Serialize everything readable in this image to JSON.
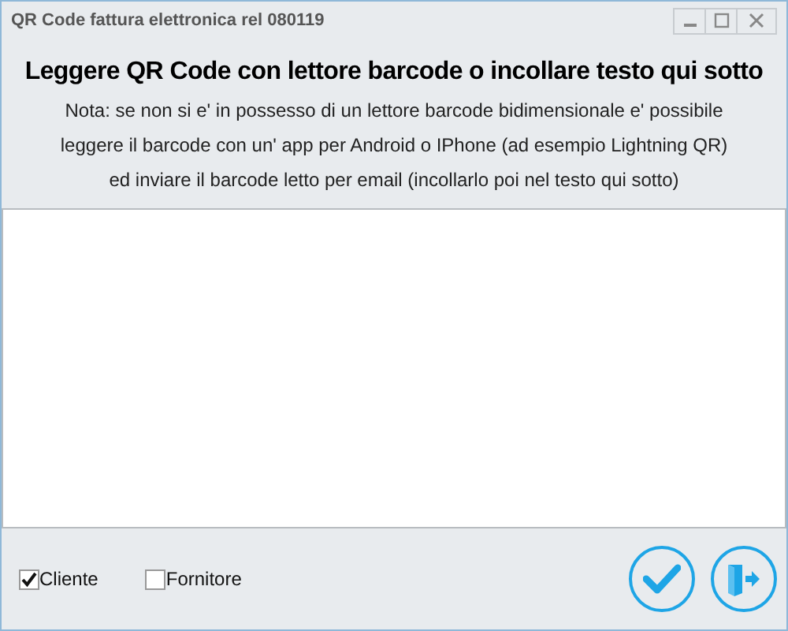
{
  "window": {
    "title": "QR Code fattura elettronica rel 080119"
  },
  "heading": "Leggere QR Code con lettore barcode o incollare testo qui sotto",
  "note_lines": [
    "Nota: se non si e' in possesso di un lettore barcode bidimensionale e' possibile",
    "leggere il barcode con un' app per Android o IPhone (ad esempio Lightning QR)",
    "ed inviare il barcode letto per email (incollarlo poi nel testo qui sotto)"
  ],
  "checkboxes": [
    {
      "label": "Cliente",
      "checked": true
    },
    {
      "label": "Fornitore",
      "checked": false
    }
  ],
  "buttons": [
    {
      "kind": "confirm"
    },
    {
      "kind": "exit"
    }
  ]
}
